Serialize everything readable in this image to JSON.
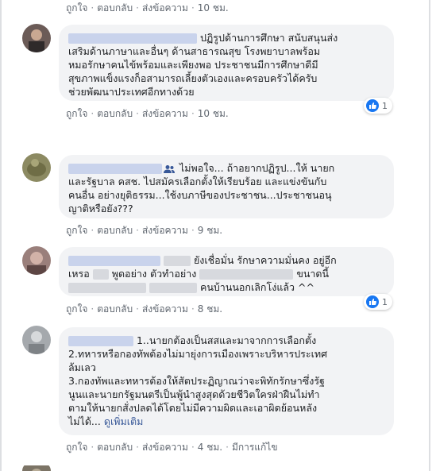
{
  "actions": {
    "like": "ถูกใจ",
    "reply": "ตอบกลับ",
    "message": "ส่งข้อความ",
    "see_more": "ดูเพิ่มเติม",
    "edited": "มีการแก้ไข"
  },
  "comments": [
    {
      "time": "10 ชม."
    },
    {
      "lines": [
        "ปฏิรูปด้านการศึกษา สนับสนุนส่ง",
        "เสริมด้านภาษาและอื่นๆ ด้านสาธารณสุข โรงพยาบาลพร้อม",
        "หมอรักษาคนไข้พร้อมและเพียงพอ ประชาชนมีการศึกษาดีมี",
        "สุขภาพแข็งแรงก็อสามารถเลี้ยงตัวเองและครอบครัวได้ครับ",
        "ช่วยพัฒนาประเทศอีกทางด้วย"
      ],
      "reactions": "1",
      "time": "10 ชม."
    },
    {
      "lines": [
        "ไม่พอใจ... ถ้าอยากปฏิรูป...ให้ นายก",
        "และรัฐบาล คสช. ไปสมัครเลือกตั้งให้เรียบร้อย และแข่งขันกับ",
        "คนอื่น อย่างยุติธรรม...ใช้งบภาษีของประชาชน...ประชาชนอนุ",
        "ญาติหรือยัง???"
      ],
      "time": "9 ชม."
    },
    {
      "lines": [
        "ยังเชื่อมั่น รักษาความมั่นคง อยู่อีก",
        "เหรอ",
        "พูดอย่าง ตัวทำอย่าง",
        "ขนาดนี้",
        "คนบ้านนอกเลิกโง่แล้ว ^^"
      ],
      "reactions": "1",
      "time": "8 ชม."
    },
    {
      "lines": [
        "1..นายกต้องเป็นสสและมาจากการเลือกตั้ง",
        "2.ทหารหรือกองทัพต้องไม่มายุ่งการเมืองเพราะบริหารประเทศ",
        "ล้มเลว",
        "3.กองทัพและทหารต้องให้สัตประฏิญาณว่าจะพิทักรักษาซึ่งรัฐ",
        "นูนและนายกรัฐมนตรีเป็นพู้นำสูงสุดด้วยชีวิตใครฝ่าฝืนไม่ทำ",
        "ตามให้นายกสั่งปลดได้โดยไม่มีความผิดและเอาผิดย้อนหลัง",
        "ไม่ได้..."
      ],
      "time": "4 ชม."
    }
  ]
}
